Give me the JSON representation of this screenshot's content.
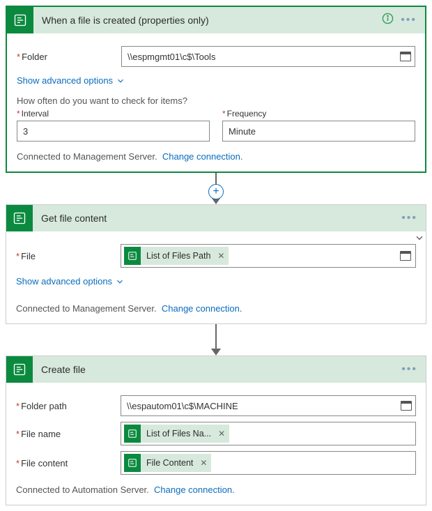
{
  "cards": {
    "trigger": {
      "title": "When a file is created (properties only)",
      "folder_label": "Folder",
      "folder_value": "\\\\espmgmt01\\c$\\Tools",
      "adv_label": "Show advanced options",
      "prompt": "How often do you want to check for items?",
      "interval_label": "Interval",
      "interval_value": "3",
      "frequency_label": "Frequency",
      "frequency_value": "Minute",
      "conn_text": "Connected to Management Server.",
      "conn_link": "Change connection."
    },
    "getfile": {
      "title": "Get file content",
      "file_label": "File",
      "file_token": "List of Files Path",
      "adv_label": "Show advanced options",
      "conn_text": "Connected to Management Server.",
      "conn_link": "Change connection."
    },
    "createfile": {
      "title": "Create file",
      "folderpath_label": "Folder path",
      "folderpath_value": "\\\\espautom01\\c$\\MACHINE",
      "filename_label": "File name",
      "filename_token": "List of Files Na...",
      "filecontent_label": "File content",
      "filecontent_token": "File Content",
      "conn_text": "Connected to Automation Server.",
      "conn_link": "Change connection."
    }
  }
}
